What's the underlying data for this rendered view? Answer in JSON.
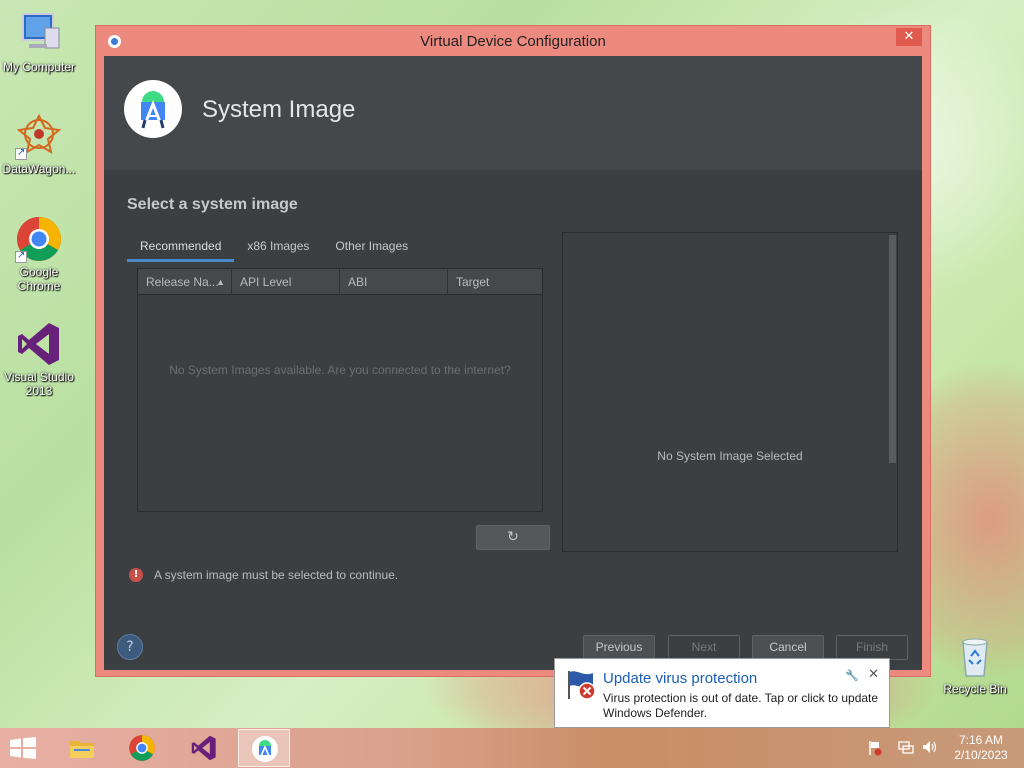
{
  "desktop": {
    "icons": [
      {
        "label": "My Computer"
      },
      {
        "label": "DataWagon..."
      },
      {
        "label": "Google Chrome"
      },
      {
        "label": "Visual Studio 2013"
      },
      {
        "label": "Recycle Bin"
      }
    ]
  },
  "window": {
    "title": "Virtual Device Configuration",
    "close_label": "✕"
  },
  "header": {
    "title": "System Image"
  },
  "main": {
    "section_title": "Select a system image",
    "tabs": [
      {
        "label": "Recommended",
        "active": true
      },
      {
        "label": "x86 Images",
        "active": false
      },
      {
        "label": "Other Images",
        "active": false
      }
    ],
    "table": {
      "columns": [
        "Release Na...",
        "API Level",
        "ABI",
        "Target"
      ],
      "empty_message": "No System Images available. Are you connected to the internet?"
    },
    "refresh_icon": "↻",
    "detail": {
      "message": "No System Image Selected"
    },
    "error": {
      "icon": "!",
      "text": "A system image must be selected to continue."
    }
  },
  "footer": {
    "help_label": "?",
    "previous_label": "Previous",
    "next_label": "Next",
    "cancel_label": "Cancel",
    "finish_label": "Finish"
  },
  "notification": {
    "title": "Update virus protection",
    "body": "Virus protection is out of date. Tap or click to update Windows Defender.",
    "close_label": "✕"
  },
  "taskbar": {
    "time": "7:16 AM",
    "date": "2/10/2023"
  }
}
